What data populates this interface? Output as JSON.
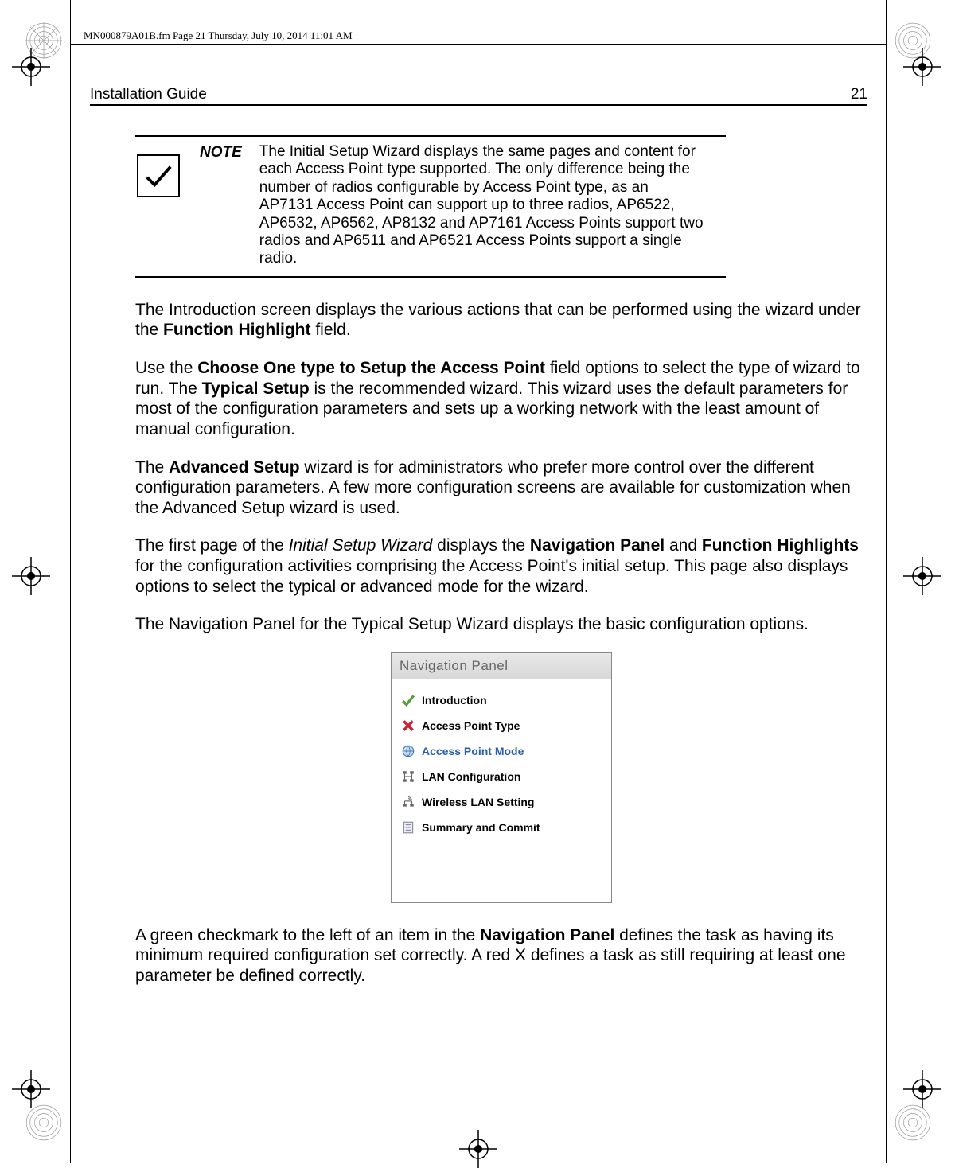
{
  "header_annotation": "MN000879A01B.fm  Page 21  Thursday, July 10, 2014  11:01 AM",
  "running": {
    "left": "Installation Guide",
    "right": "21"
  },
  "note": {
    "label": "NOTE",
    "body": "The Initial Setup Wizard displays the same pages and content for each Access Point type supported. The only difference being the number of radios configurable by Access Point type, as an AP7131 Access Point can support up to three radios, AP6522, AP6532, AP6562, AP8132 and AP7161 Access Points support two radios and AP6511 and AP6521 Access Points support a single radio."
  },
  "paragraphs": {
    "p1a": "The Introduction screen displays the various actions that can be performed using the wizard under the ",
    "p1b": "Function Highlight",
    "p1c": " field.",
    "p2a": "Use the ",
    "p2b": "Choose One type to Setup the Access Point",
    "p2c": " field options to select the type of wizard to run. The ",
    "p2d": "Typical Setup",
    "p2e": " is the recommended wizard. This wizard uses the default parameters for most of the configuration parameters and sets up a working network with the least amount of manual configuration.",
    "p3a": "The ",
    "p3b": "Advanced Setup",
    "p3c": " wizard is for administrators who prefer more control over the different configuration parameters. A few more configuration screens are available for customization when the Advanced Setup wizard is used.",
    "p4a": "The first page of the ",
    "p4b": "Initial Setup Wizard",
    "p4c": " displays the ",
    "p4d": "Navigation Panel",
    "p4e": " and ",
    "p4f": "Function Highlights",
    "p4g": " for the configuration activities comprising the Access Point's initial setup. This page also displays options to select the typical or advanced mode for the wizard.",
    "p5": "The Navigation Panel for the Typical Setup Wizard displays the basic configuration options.",
    "p6a": "A green checkmark to the left of an item in the ",
    "p6b": "Navigation Panel",
    "p6c": " defines the task as having its minimum required configuration set correctly. A red X defines a task as still requiring at least one parameter be defined correctly."
  },
  "nav_panel": {
    "title": "Navigation Panel",
    "items": [
      {
        "label": "Introduction",
        "icon": "check-green"
      },
      {
        "label": "Access Point Type",
        "icon": "x-red"
      },
      {
        "label": "Access Point Mode",
        "icon": "globe-blue",
        "cls": "blue"
      },
      {
        "label": "LAN Configuration",
        "icon": "lan"
      },
      {
        "label": "Wireless LAN Setting",
        "icon": "wlan"
      },
      {
        "label": "Summary and Commit",
        "icon": "doc"
      }
    ]
  }
}
